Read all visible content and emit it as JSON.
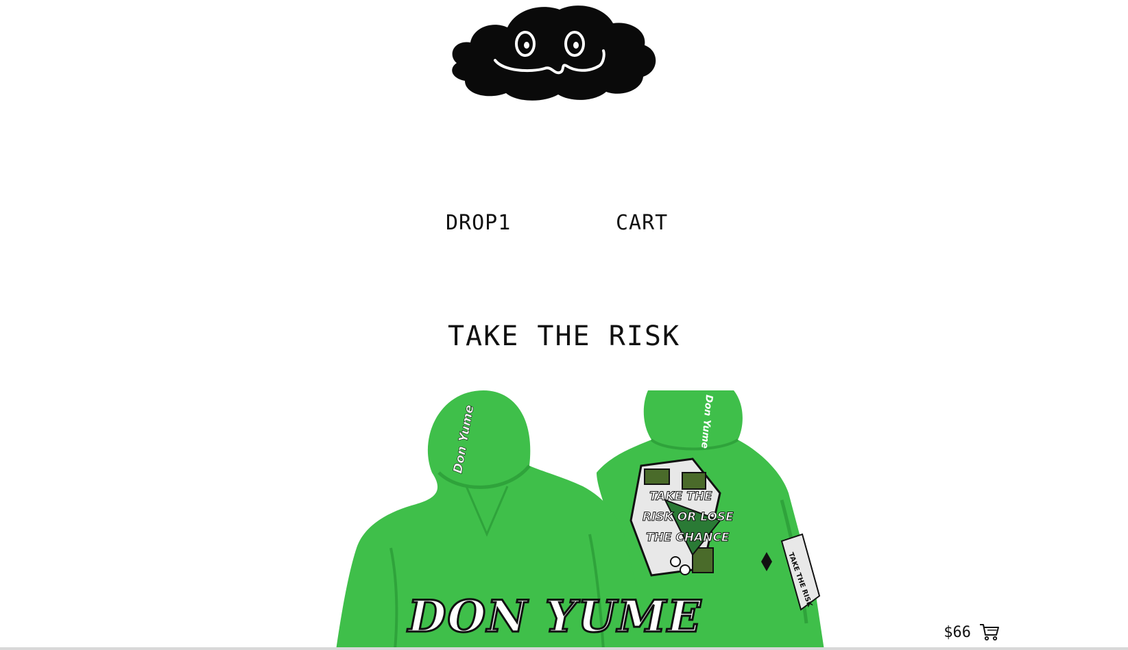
{
  "brand": {
    "logo_icon": "cloud-face-logo-icon"
  },
  "nav": {
    "items": [
      {
        "label": "DROP1"
      },
      {
        "label": "CART"
      }
    ]
  },
  "hero": {
    "title": "TAKE THE RISK"
  },
  "product": {
    "image_icon": "green-hoodie-front-back-image",
    "front_print": "DON YUME",
    "back_print": "TAKE THE RISK OR LOSE THE CHANCE",
    "price": "$66",
    "cart_icon": "shopping-cart-icon",
    "colors": {
      "hoodie": "#3fbf4a",
      "hoodie_shadow": "#2fa33b"
    }
  }
}
